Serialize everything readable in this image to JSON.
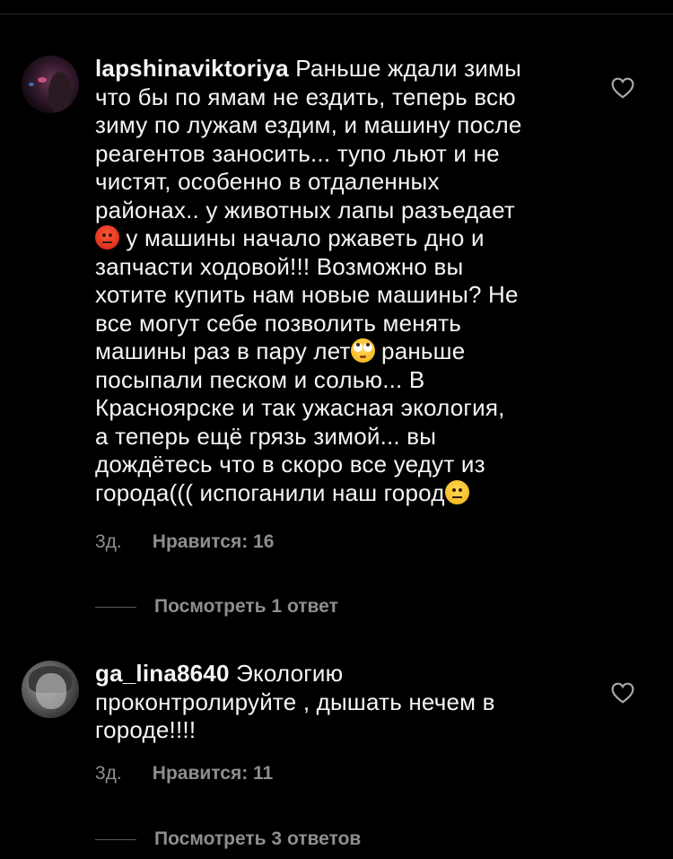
{
  "comments": [
    {
      "username": "lapshinaviktoriya",
      "text_1": " Раньше ждали зимы\nчто бы по ямам не ездить, теперь всю\nзиму по лужам ездим, и машину после\nреагентов заносить... тупо льют и не\nчистят, особенно в отдаленных\nрайонах.. у животных лапы разъедает\n",
      "text_2": " у машины начало ржаветь дно и\nзапчасти ходовой!!! Возможно вы\nхотите купить нам новые машины? Не\nвсе могут себе позволить менять\nмашины раз в пару лет",
      "text_3": " раньше\nпосыпали песком и солью... В\nКрасноярске и так ужасная экология,\nа теперь ещё грязь зимой... вы\nдождётесь что в скоро все уедут из\nгорода((( испоганили наш город",
      "time": "3д.",
      "likes": "Нравится: 16",
      "view_replies": "Посмотреть 1 ответ"
    },
    {
      "username": "ga_lina8640",
      "text_1": " Экологию\nпроконтролируйте , дышать нечем в\nгороде!!!!",
      "time": "3д.",
      "likes": "Нравится: 11",
      "view_replies": "Посмотреть 3 ответов"
    }
  ],
  "icons": {
    "like": "heart-outline-icon",
    "emoji_1": "angry-face-emoji",
    "emoji_2": "rolling-eyes-emoji",
    "emoji_3": "neutral-face-emoji"
  },
  "colors": {
    "background": "#000000",
    "text": "#f5f5f5",
    "secondary": "#8e8e8e",
    "divider": "#262626"
  }
}
